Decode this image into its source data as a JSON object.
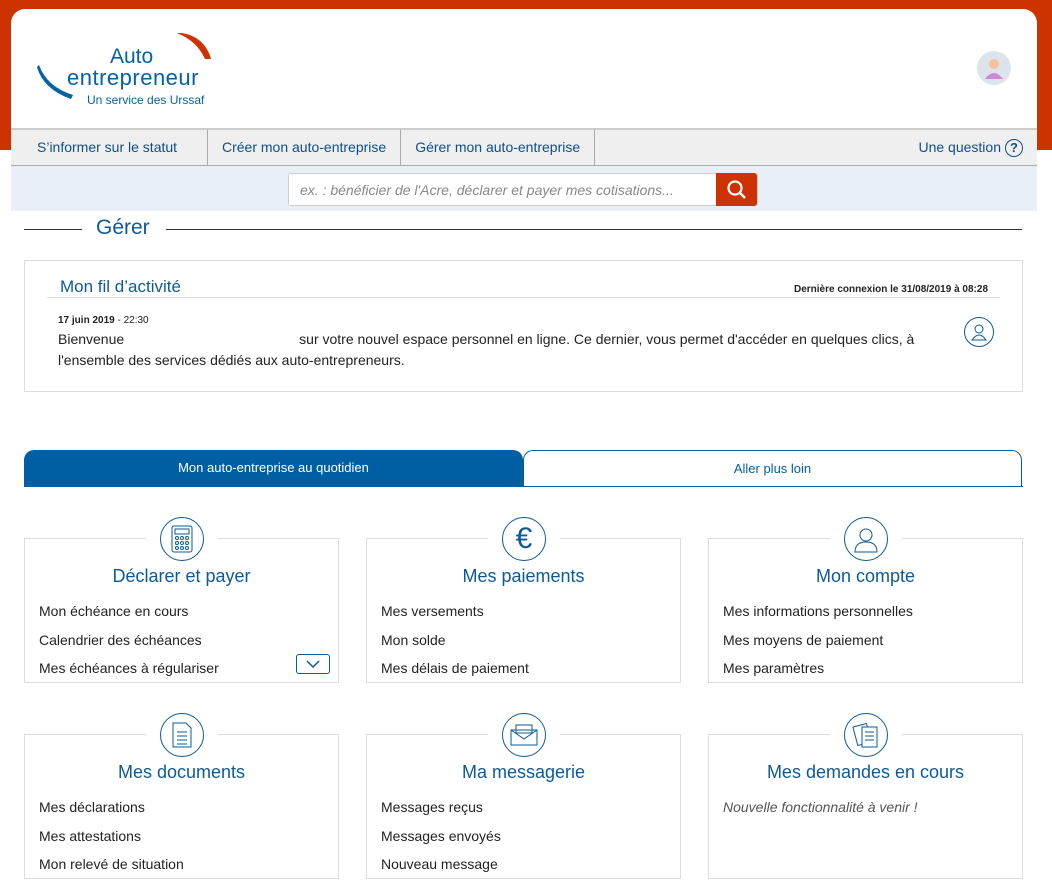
{
  "header": {
    "logo": {
      "line1": "Auto",
      "line2": "entrepreneur",
      "line3": "Un service des Urssaf"
    }
  },
  "nav": {
    "items": [
      "S’informer sur le statut",
      "Créer mon auto-entreprise",
      "Gérer mon auto-entreprise"
    ],
    "question": "Une question",
    "question_icon": "?"
  },
  "search": {
    "placeholder": "ex. : bénéficier de l'Acre, déclarer et payer mes cotisations..."
  },
  "section_title": "Gérer",
  "activity": {
    "title": "Mon fil d’activité",
    "last_login": "Dernière connexion le 31/08/2019 à 08:28",
    "date": "17 juin 2019",
    "time": " - 22:30",
    "msg_start": "Bienvenue",
    "msg_rest": "sur votre nouvel espace personnel en ligne. Ce dernier, vous permet d'accéder en quelques clics, à l'ensemble des services dédiés aux auto-entrepreneurs."
  },
  "tabs": [
    "Mon auto-entreprise au quotidien",
    "Aller plus loin"
  ],
  "cards": [
    {
      "title": "Déclarer et payer",
      "links": [
        "Mon échéance en cours",
        "Calendrier des échéances",
        "Mes échéances à régulariser"
      ]
    },
    {
      "title": "Mes paiements",
      "links": [
        "Mes versements",
        "Mon solde",
        "Mes délais de paiement"
      ],
      "icon": "€"
    },
    {
      "title": "Mon compte",
      "links": [
        "Mes informations personnelles",
        "Mes moyens de paiement",
        "Mes paramètres"
      ]
    },
    {
      "title": "Mes documents",
      "links": [
        "Mes déclarations",
        "Mes attestations",
        "Mon relevé de situation"
      ]
    },
    {
      "title": "Ma messagerie",
      "links": [
        "Messages reçus",
        "Messages envoyés",
        "Nouveau message"
      ]
    },
    {
      "title": "Mes demandes en cours",
      "note": "Nouvelle fonctionnalité à venir !"
    }
  ],
  "colors": {
    "brand_red": "#cc3300",
    "brand_blue": "#005fa3"
  }
}
